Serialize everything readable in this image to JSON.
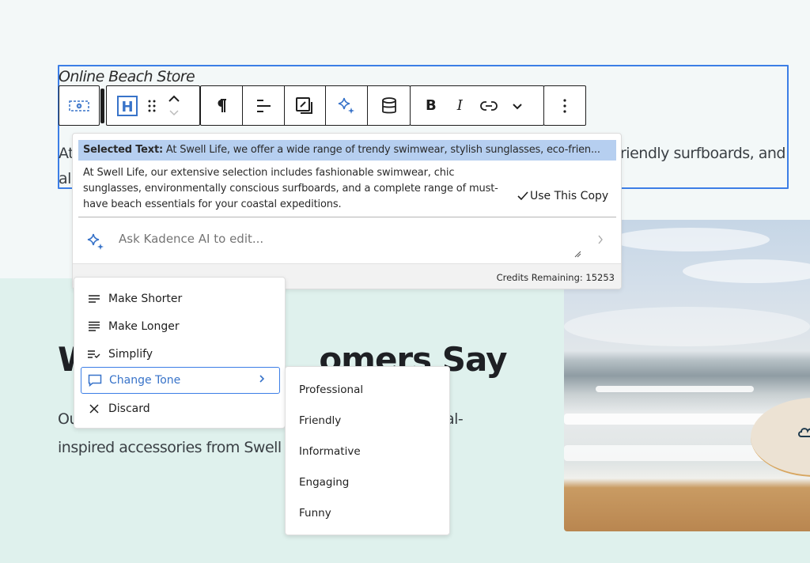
{
  "page": {
    "store_title": "Online Beach Store",
    "paragraph": {
      "line1_start": "At",
      "line1_end": "riendly surfboards, and",
      "line2_start": "al"
    },
    "section_heading_left": "W",
    "section_heading_right": "omers Say",
    "section_body_line1_start": "Ou",
    "section_body_line1_end": "al-",
    "section_body_line2": "inspired accessories from Swell l"
  },
  "toolbar": {
    "groups": [
      {
        "buttons": [
          {
            "icon": "block-placeholder-icon",
            "label": "Block type"
          }
        ]
      },
      {
        "buttons": [
          {
            "icon": "heading-icon",
            "label": "H"
          },
          {
            "icon": "drag-icon",
            "label": "Drag"
          },
          {
            "icon": "move-updown-icon",
            "label": "Move up/down"
          }
        ]
      },
      {
        "buttons": [
          {
            "icon": "paragraph-icon",
            "label": "¶"
          },
          {
            "icon": "align-icon",
            "label": "Align"
          },
          {
            "icon": "edit-copy-icon",
            "label": "Edit"
          },
          {
            "icon": "ai-sparkle-icon",
            "label": "Kadence AI"
          },
          {
            "icon": "database-icon",
            "label": "Dynamic content"
          }
        ]
      },
      {
        "buttons": [
          {
            "icon": "bold-icon",
            "label": "B"
          },
          {
            "icon": "italic-icon",
            "label": "I"
          },
          {
            "icon": "link-icon",
            "label": "Link"
          },
          {
            "icon": "chevron-down-icon",
            "label": "More"
          }
        ]
      },
      {
        "buttons": [
          {
            "icon": "more-vertical-icon",
            "label": "Options"
          }
        ]
      }
    ]
  },
  "ai_popover": {
    "selected_label": "Selected Text:",
    "selected_text": "At Swell Life, we offer a wide range of trendy swimwear, stylish sunglasses, eco-frien...",
    "result_text": "At Swell Life, our extensive selection includes fashionable swimwear, chic sunglasses, environmentally conscious surfboards, and a complete range of must-have beach essentials for your coastal expeditions.",
    "use_copy_label": "Use This Copy",
    "ask_placeholder": "Ask Kadence AI to edit...",
    "credits_label": "Credits Remaining: 15253",
    "accent_color": "#3873c9"
  },
  "menu": {
    "items": [
      {
        "label": "Make Shorter",
        "icon": "make-shorter-icon"
      },
      {
        "label": "Make Longer",
        "icon": "make-longer-icon"
      },
      {
        "label": "Simplify",
        "icon": "simplify-icon"
      },
      {
        "label": "Change Tone",
        "icon": "comment-icon",
        "active": true
      },
      {
        "label": "Discard",
        "icon": "close-icon"
      }
    ]
  },
  "tone_submenu": {
    "items": [
      "Professional",
      "Friendly",
      "Informative",
      "Engaging",
      "Funny"
    ]
  }
}
